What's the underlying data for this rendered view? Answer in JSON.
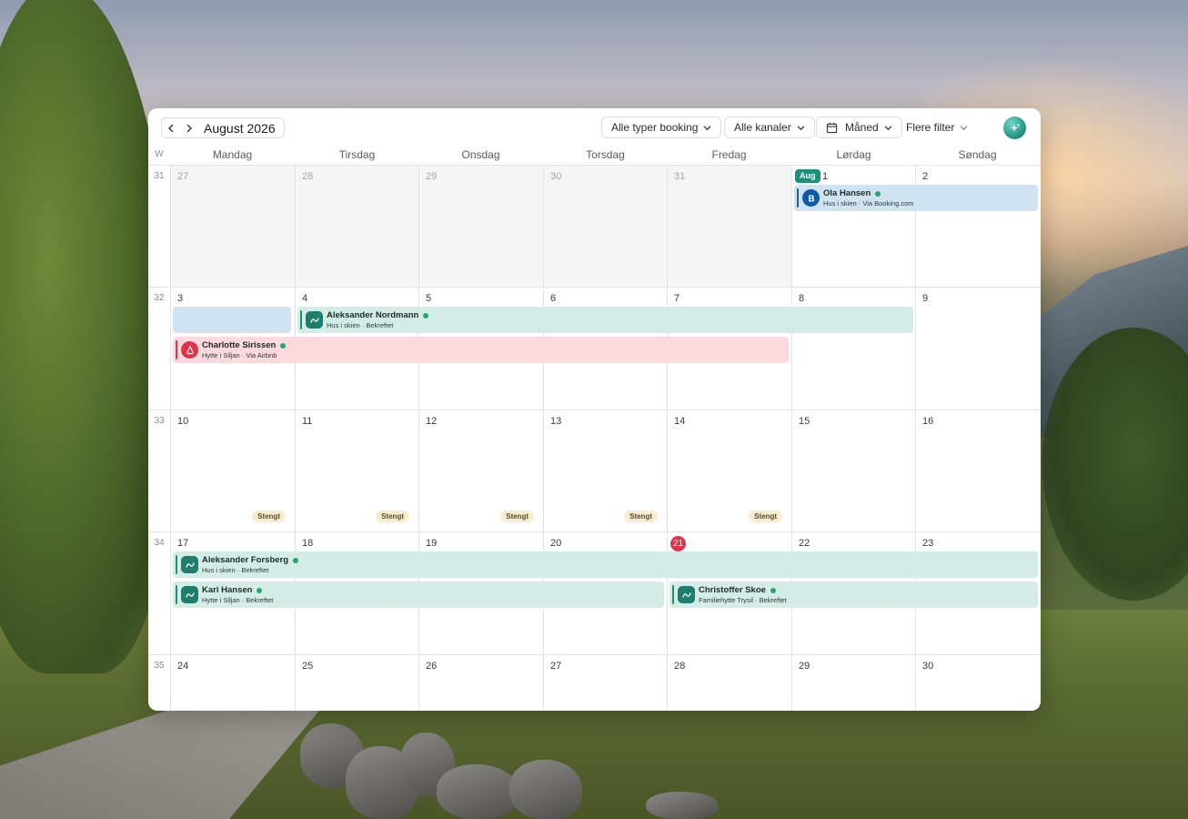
{
  "colors": {
    "accent": "#1f8f7a",
    "today": "#e0334a",
    "booking_lodgr": "#d3ede6",
    "booking_bookingcom": "#cfe3f3",
    "booking_airbnb": "#fbd9dd",
    "closed_badge": "#fbecd2"
  },
  "toolbar": {
    "month_title": "August 2026",
    "prev_icon": "chevron-left-icon",
    "next_icon": "chevron-right-icon",
    "filter_booking_types": "Alle typer booking",
    "filter_channels": "Alle kanaler",
    "filter_view": "Måned",
    "filter_more": "Flere filter",
    "ai_icon": "sparkle-icon"
  },
  "calendar": {
    "week_header": "W",
    "day_names": [
      "Mandag",
      "Tirsdag",
      "Onsdag",
      "Torsdag",
      "Fredag",
      "Lørdag",
      "Søndag"
    ],
    "month_pill": "Aug",
    "closed_label": "Stengt",
    "weeks": [
      {
        "number": "31",
        "days": [
          "27",
          "28",
          "29",
          "30",
          "31",
          "1",
          "2"
        ]
      },
      {
        "number": "32",
        "days": [
          "3",
          "4",
          "5",
          "6",
          "7",
          "8",
          "9"
        ]
      },
      {
        "number": "33",
        "days": [
          "10",
          "11",
          "12",
          "13",
          "14",
          "15",
          "16"
        ]
      },
      {
        "number": "34",
        "days": [
          "17",
          "18",
          "19",
          "20",
          "21",
          "22",
          "23"
        ]
      },
      {
        "number": "35",
        "days": [
          "24",
          "25",
          "26",
          "27",
          "28",
          "29",
          "30"
        ]
      }
    ],
    "today": "21"
  },
  "bookings": [
    {
      "name": "Ola Hansen",
      "detail": "Hus i skien · Via Booking.com",
      "channel": "booking-com-icon"
    },
    {
      "name": "Aleksander Nordmann",
      "detail": "Hus i skien · Bekreftet",
      "channel": "lodgr-icon"
    },
    {
      "name": "Charlotte Sirissen",
      "detail": "Hytte i Siljan · Via Airbnb",
      "channel": "airbnb-icon"
    },
    {
      "name": "Aleksander Forsberg",
      "detail": "Hus i skien · Bekreftet",
      "channel": "lodgr-icon"
    },
    {
      "name": "Kari Hansen",
      "detail": "Hytte i Siljan · Bekreftet",
      "channel": "lodgr-icon"
    },
    {
      "name": "Christoffer Skoe",
      "detail": "Familiehytte Trysil · Bekreftet",
      "channel": "lodgr-icon"
    }
  ]
}
